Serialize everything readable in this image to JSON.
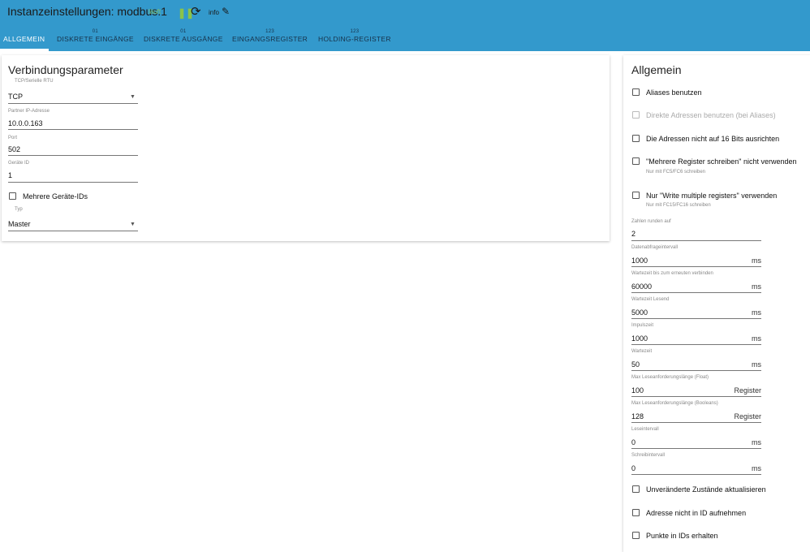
{
  "header": {
    "title": "Instanzeinstellungen: modbus.1",
    "status": "läuft",
    "info_label": "info",
    "icons": [
      "pause-icon",
      "reload-icon",
      "pencil-icon"
    ]
  },
  "tabs": [
    {
      "sup": "",
      "label": "ALLGEMEIN"
    },
    {
      "sup": "01",
      "label": "DISKRETE EINGÄNGE"
    },
    {
      "sup": "01",
      "label": "DISKRETE AUSGÄNGE"
    },
    {
      "sup": "123",
      "label": "EINGANGSREGISTER"
    },
    {
      "sup": "123",
      "label": "HOLDING-REGISTER"
    }
  ],
  "connection": {
    "title": "Verbindungsparameter",
    "type_label": "TCP/Serielle RTU",
    "type_value": "TCP",
    "ip_label": "Partner IP-Adresse",
    "ip_value": "10.0.0.163",
    "port_label": "Port",
    "port_value": "502",
    "device_label": "Geräte ID",
    "device_value": "1",
    "multi_ids_label": "Mehrere Geräte-IDs",
    "role_label": "Typ",
    "role_value": "Master"
  },
  "general": {
    "title": "Allgemein",
    "checkboxes": [
      {
        "label": "Aliases benutzen",
        "hint": ""
      },
      {
        "label": "Direkte Adressen benutzen (bei Aliases)",
        "hint": ""
      },
      {
        "label": "Die Adressen nicht auf 16 Bits ausrichten",
        "hint": ""
      },
      {
        "label": "\"Mehrere Register schreiben\" nicht verwenden",
        "hint": "Nur mit FC5/FC6 schreiben"
      },
      {
        "label": "Nur \"Write multiple registers\" verwenden",
        "hint": "Nur mit FC15/FC16 schreiben"
      }
    ],
    "fields": [
      {
        "label": "Zahlen runden auf",
        "value": "2",
        "unit": ""
      },
      {
        "label": "Datenabfrageintervall",
        "value": "1000",
        "unit": "ms"
      },
      {
        "label": "Wartezeit bis zum erneuten verbinden",
        "value": "60000",
        "unit": "ms"
      },
      {
        "label": "Wartezeit Lesend",
        "value": "5000",
        "unit": "ms"
      },
      {
        "label": "Impulszeit",
        "value": "1000",
        "unit": "ms"
      },
      {
        "label": "Wartezeit",
        "value": "50",
        "unit": "ms"
      },
      {
        "label": "Max Leseanforderungslänge (Float)",
        "value": "100",
        "unit": "Register"
      },
      {
        "label": "Max Leseanforderungslänge (Booleans)",
        "value": "128",
        "unit": "Register"
      },
      {
        "label": "Leseintervall",
        "value": "0",
        "unit": "ms"
      },
      {
        "label": "Schreibintervall",
        "value": "0",
        "unit": "ms"
      }
    ],
    "bottom_checkboxes": [
      {
        "label": "Unveränderte Zustände aktualisieren"
      },
      {
        "label": "Adresse nicht in ID aufnehmen"
      },
      {
        "label": "Punkte in IDs erhalten"
      }
    ]
  }
}
